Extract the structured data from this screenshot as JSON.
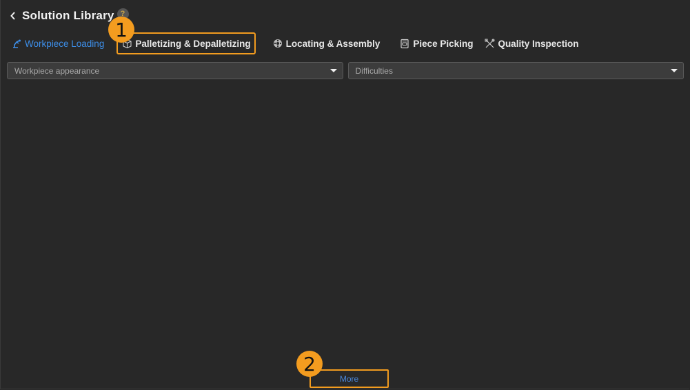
{
  "header": {
    "title": "Solution Library",
    "help_label": "?"
  },
  "tabs": [
    {
      "label": "Workpiece Loading",
      "icon": "robot-arm-icon",
      "active": true
    },
    {
      "label": "Palletizing & Depalletizing",
      "icon": "box-icon",
      "active": false
    },
    {
      "label": "Locating & Assembly",
      "icon": "gear-wheel-icon",
      "active": false
    },
    {
      "label": "Piece Picking",
      "icon": "package-icon",
      "active": false
    },
    {
      "label": "Quality Inspection",
      "icon": "tools-icon",
      "active": false
    }
  ],
  "filters": {
    "appearance_placeholder": "Workpiece appearance",
    "difficulties_placeholder": "Difficulties"
  },
  "more_label": "More",
  "annotations": {
    "badge1": "1",
    "badge2": "2"
  },
  "colors": {
    "background": "#282828",
    "accent_blue": "#3d8ee8",
    "highlight_orange": "#f39c1f"
  }
}
